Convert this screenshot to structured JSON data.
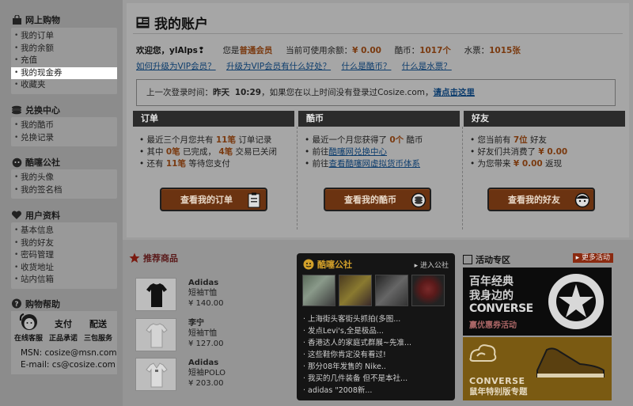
{
  "sidebar": {
    "shop": {
      "title": "网上购物",
      "items": [
        "我的订单",
        "我的余额",
        "充值",
        "我的现金券",
        "收藏夹"
      ]
    },
    "exchange": {
      "title": "兑换中心",
      "items": [
        "我的酷币",
        "兑换记录"
      ]
    },
    "club": {
      "title": "酷噻公社",
      "items": [
        "我的头像",
        "我的签名档"
      ]
    },
    "profile": {
      "title": "用户资料",
      "items": [
        "基本信息",
        "我的好友",
        "密码管理",
        "收货地址",
        "站内信箱"
      ]
    },
    "help": {
      "title": "购物帮助",
      "service_label": "在线客服",
      "pay_title": "支付",
      "pay_sub": "正品承诺",
      "ship_title": "配送",
      "ship_sub": "三包服务",
      "msn": "MSN: cosize@msn.com",
      "email": "E-mail: cs@cosize.com"
    }
  },
  "page": {
    "title": "我的账户"
  },
  "welcome": {
    "greet": "欢迎您，",
    "user": "ylAlps",
    "member_pre": "您是",
    "member_level": "普通会员",
    "balance_label": "当前可使用余额：",
    "balance": "¥ 0.00",
    "coin_label": "酷币：",
    "coin": "1017个",
    "ticket_label": "水票：",
    "ticket": "1015张"
  },
  "links": [
    "如何升级为VIP会员？",
    "升级为VIP会员有什么好处？",
    "什么是酷币？",
    "什么是水票？"
  ],
  "notice": {
    "label": "上一次登录时间：",
    "day": "昨天",
    "time": "10:29",
    "text": "，如果您在以上时间没有登录过Cosize.com，",
    "link": "请点击这里"
  },
  "orders": {
    "head": "订单",
    "l1a": "最近三个月您共有",
    "l1b": "11笔",
    "l1c": "订单记录",
    "l2a": "其中",
    "l2b": "0笔",
    "l2c": "已完成，",
    "l2d": "4笔",
    "l2e": "交易已关闭",
    "l3a": "还有",
    "l3b": "11笔",
    "l3c": "等待您支付",
    "button": "查看我的订单"
  },
  "coins": {
    "head": "酷币",
    "l1a": "最近一个月您获得了",
    "l1b": "0个",
    "l1c": "酷币",
    "l2a": "前往",
    "l2b": "酷噻网兑换中心",
    "l3a": "前往",
    "l3b": "查看酷噻网虚拟货币体系",
    "button": "查看我的酷币"
  },
  "friends": {
    "head": "好友",
    "l1a": "您当前有",
    "l1b": "7位",
    "l1c": "好友",
    "l2a": "好友们共消费了",
    "l2b": "¥ 0.00",
    "l3a": "为您带来",
    "l3b": "¥ 0.00",
    "l3c": "返现",
    "button": "查看我的好友"
  },
  "recommend": {
    "title": "推荐商品",
    "products": [
      {
        "brand": "Adidas",
        "name": "短袖T恤",
        "price": "¥ 140.00"
      },
      {
        "brand": "李宁",
        "name": "短袖T恤",
        "price": "¥ 127.00"
      },
      {
        "brand": "Adidas",
        "name": "短袖POLO",
        "price": "¥ 203.00"
      }
    ]
  },
  "club": {
    "title": "酷噻公社",
    "more": "▸ 进入公社",
    "posts": [
      "上海街头客街头抓拍(多图...",
      "发点Levi's,全是极品...",
      "香港达人的家庭式群展~先准...",
      "这些鞋你肯定没有看过!",
      "那分08年发售的  Nike..",
      "我买的几件装备  但不是本社...",
      "adidas \"2008新..."
    ]
  },
  "promo": {
    "title": "活动专区",
    "more": "▸ 更多活动",
    "b1_l1": "百年经典",
    "b1_l2": "我身边的",
    "b1_l3": "CONVERSE",
    "b1_l4": "赢优惠券活动",
    "b2_l1": "CONVERSE",
    "b2_l2": "鼠年特别版专题"
  },
  "colors": {
    "accent": "#7a3a10",
    "link": "#0d3d6d",
    "dark": "#2b2b2b"
  }
}
